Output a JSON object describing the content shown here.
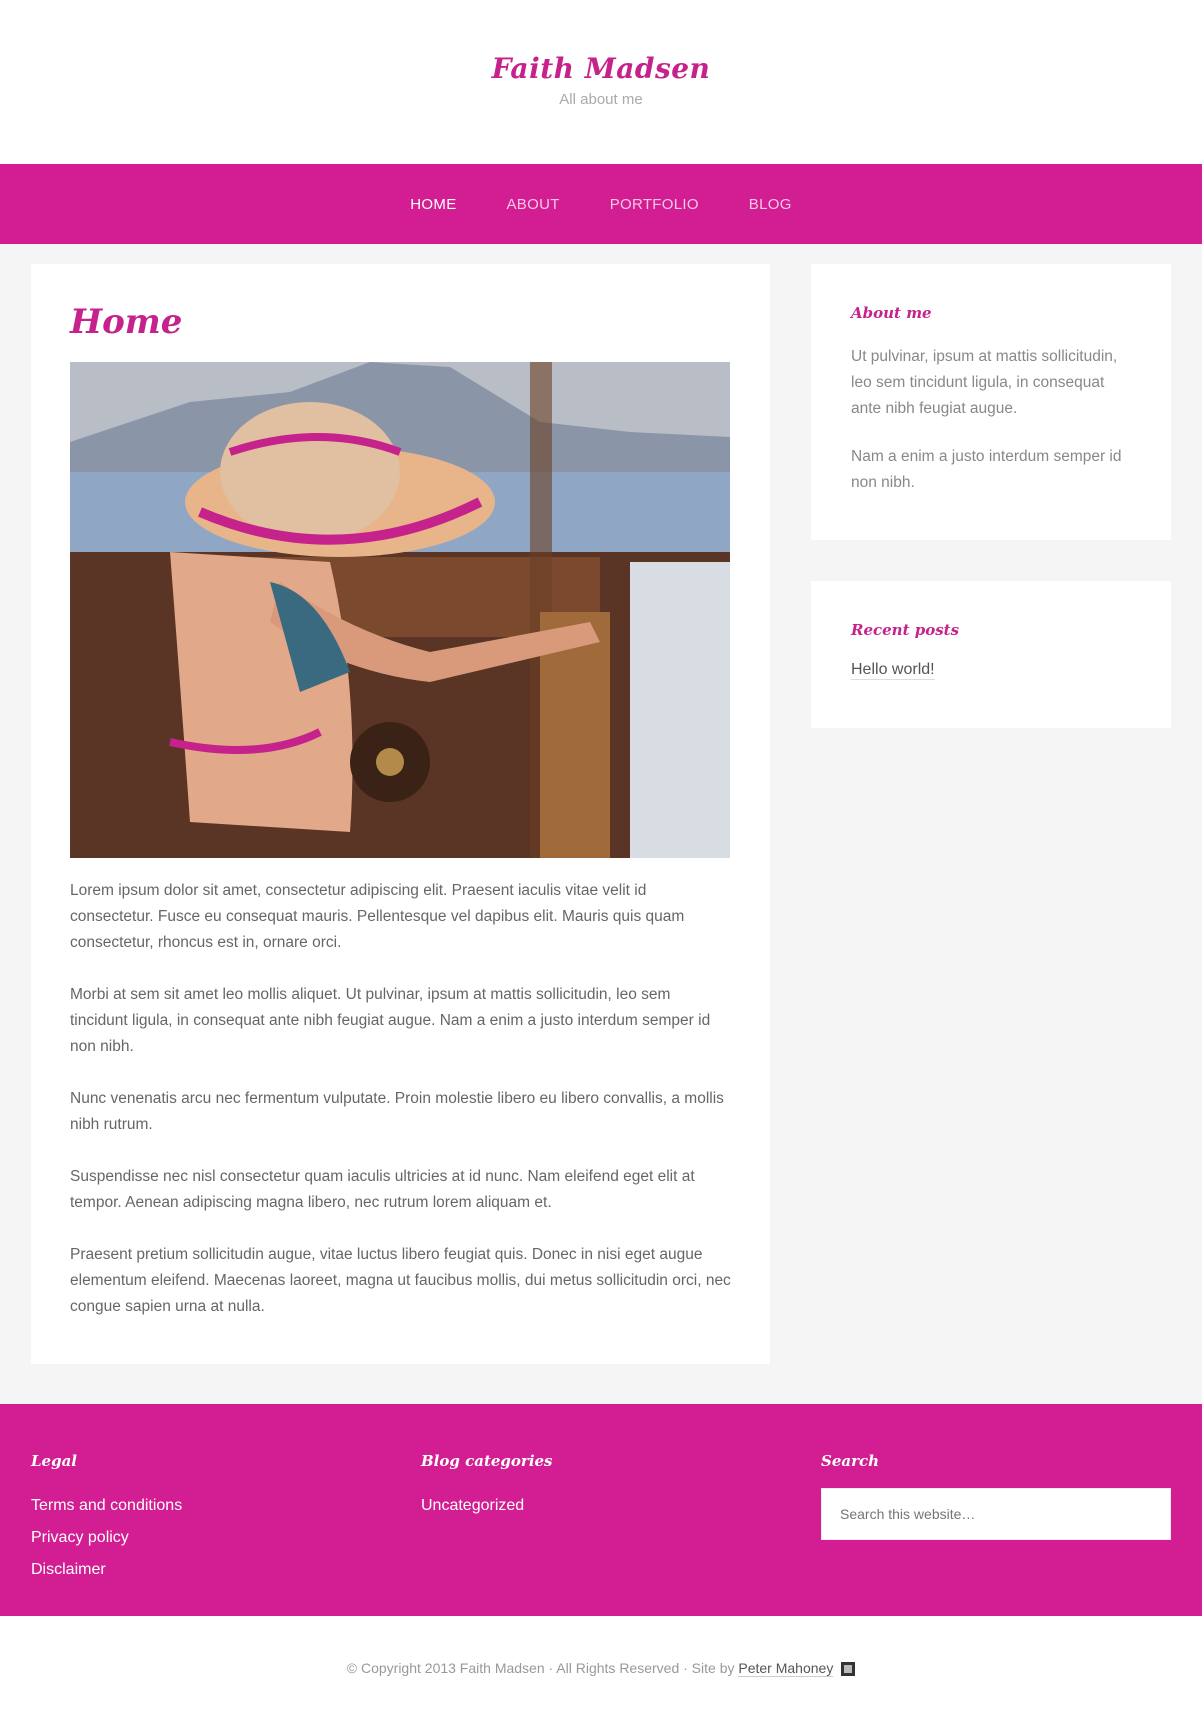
{
  "header": {
    "title": "Faith Madsen",
    "description": "All about me"
  },
  "nav": {
    "items": [
      "HOME",
      "ABOUT",
      "PORTFOLIO",
      "BLOG"
    ]
  },
  "main": {
    "title": "Home",
    "paragraphs": [
      "Lorem ipsum dolor sit amet, consectetur adipiscing elit. Praesent iaculis vitae velit id consectetur. Fusce eu consequat mauris. Pellentesque vel dapibus elit. Mauris quis quam consectetur, rhoncus est in, ornare orci.",
      "Morbi at sem sit amet leo mollis aliquet. Ut pulvinar, ipsum at mattis sollicitudin, leo sem tincidunt ligula, in consequat ante nibh feugiat augue. Nam a enim a justo interdum semper id non nibh.",
      "Nunc venenatis arcu nec fermentum vulputate. Proin molestie libero eu libero convallis, a mollis nibh rutrum.",
      "Suspendisse nec nisl consectetur quam iaculis ultricies at id nunc. Nam eleifend eget elit at tempor. Aenean adipiscing magna libero, nec rutrum lorem aliquam et.",
      "Praesent pretium sollicitudin augue, vitae luctus libero feugiat quis. Donec in nisi eget augue elementum eleifend. Maecenas laoreet, magna ut faucibus mollis, dui metus sollicitudin orci, nec congue sapien urna at nulla."
    ]
  },
  "sidebar": {
    "about": {
      "title": "About me",
      "paragraphs": [
        "Ut pulvinar, ipsum at mattis sollicitudin, leo sem tincidunt ligula, in consequat ante nibh feugiat augue.",
        "Nam a enim a justo interdum semper id non nibh."
      ]
    },
    "recent": {
      "title": "Recent posts",
      "posts": [
        "Hello world!"
      ]
    }
  },
  "footer_widgets": {
    "legal": {
      "title": "Legal",
      "items": [
        "Terms and conditions",
        "Privacy policy",
        "Disclaimer"
      ]
    },
    "categories": {
      "title": "Blog categories",
      "items": [
        "Uncategorized"
      ]
    },
    "search": {
      "title": "Search",
      "placeholder": "Search this website…"
    }
  },
  "footer": {
    "copyright": "© Copyright 2013 Faith Madsen · All Rights Reserved · Site by",
    "credit": "Peter Mahoney"
  },
  "colors": {
    "accent": "#d21e92",
    "title": "#c5228c"
  }
}
